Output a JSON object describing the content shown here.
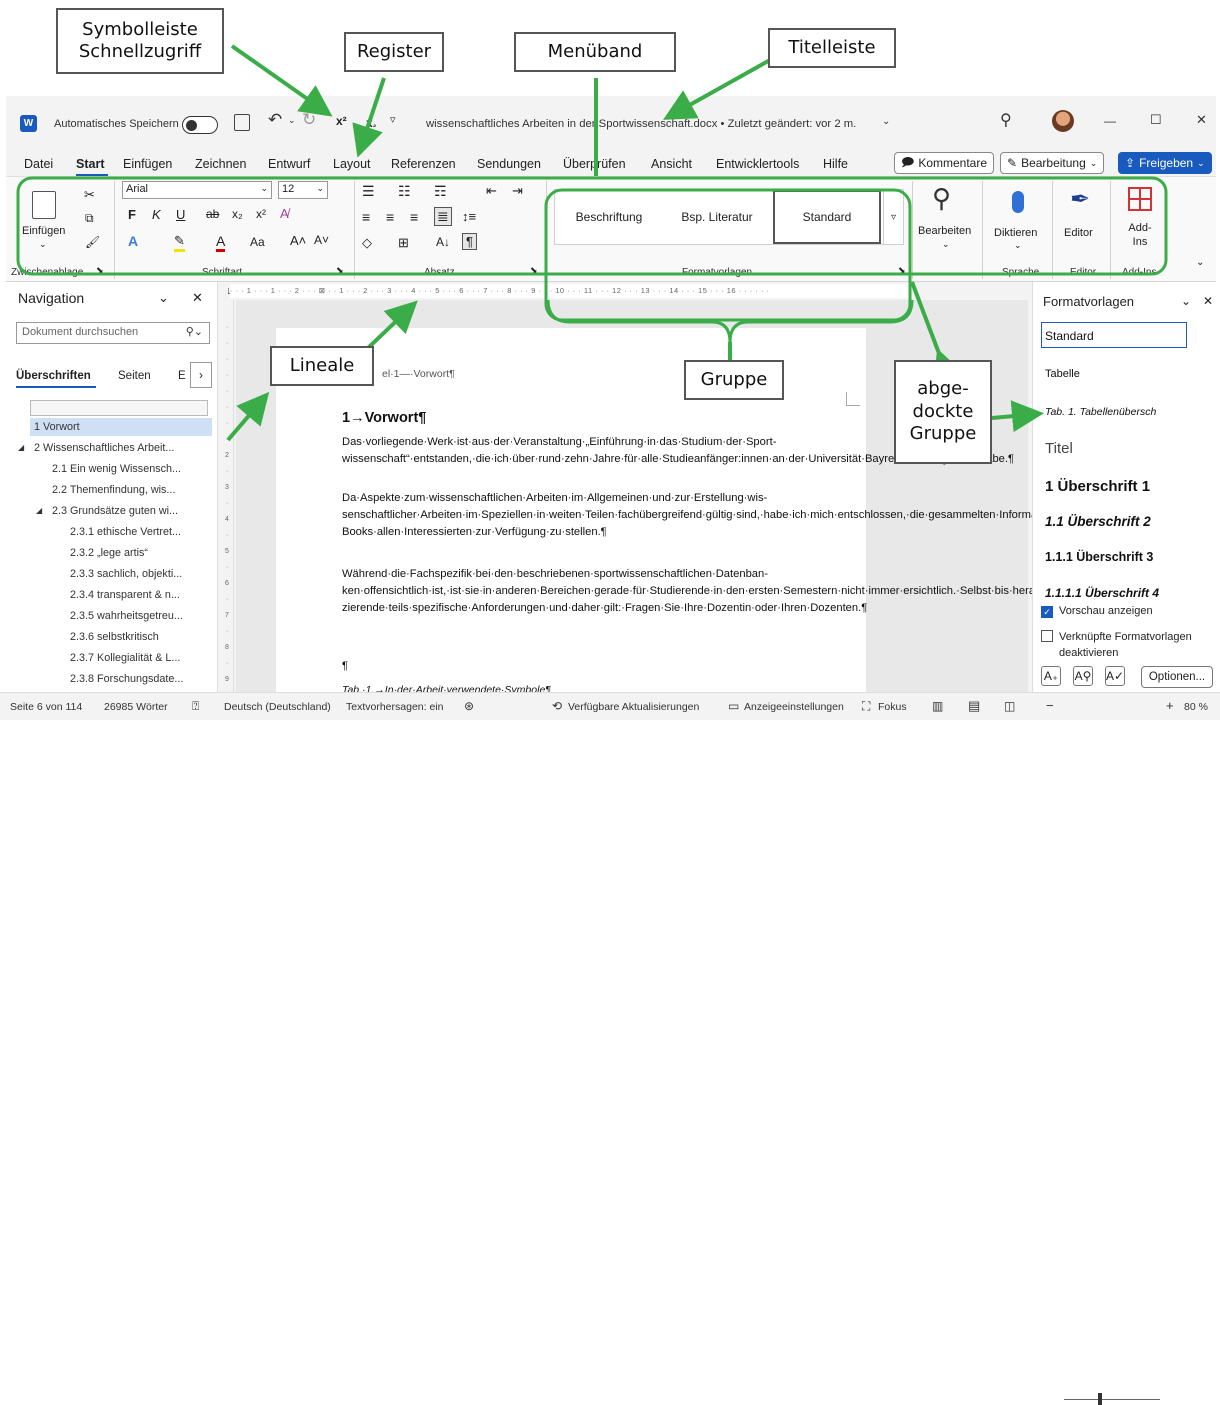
{
  "annotations": {
    "quick_access": "Symbolleiste\nSchnellzugriff",
    "register": "Register",
    "ribbon": "Menüband",
    "titlebar": "Titelleiste",
    "rulers": "Lineale",
    "group": "Gruppe",
    "docked_group": "abge-\ndockte\nGruppe"
  },
  "titlebar": {
    "autosave_label": "Automatisches Speichern",
    "doc_title": "wissenschaftliches Arbeiten in der Sportwissenschaft.docx • Zuletzt geändert: vor 2 m.",
    "minimize": "—",
    "maximize": "☐",
    "close": "✕"
  },
  "tabs": [
    "Datei",
    "Start",
    "Einfügen",
    "Zeichnen",
    "Entwurf",
    "Layout",
    "Referenzen",
    "Sendungen",
    "Überprüfen",
    "Ansicht",
    "Entwicklertools",
    "Hilfe"
  ],
  "tab_buttons": {
    "comments": "Kommentare",
    "editing": "Bearbeitung",
    "share": "Freigeben"
  },
  "ribbon": {
    "clipboard": {
      "paste": "Einfügen",
      "label": "Zwischenablage"
    },
    "font": {
      "name": "Arial",
      "size": "12",
      "label": "Schriftart",
      "bold": "F",
      "italic": "K",
      "underline": "U",
      "case": "Aa"
    },
    "paragraph": {
      "label": "Absatz"
    },
    "styles": {
      "items": [
        "Beschriftung",
        "Bsp. Literatur",
        "Standard"
      ],
      "label": "Formatvorlagen"
    },
    "editing": {
      "label": "Bearbeiten"
    },
    "voice": {
      "dictate": "Diktieren",
      "label": "Sprache"
    },
    "editor": {
      "button": "Editor",
      "label": "Editor"
    },
    "addins": {
      "button": "Add-Ins",
      "label": "Add-Ins"
    }
  },
  "navigation": {
    "title": "Navigation",
    "search_placeholder": "Dokument durchsuchen",
    "tabs": [
      "Überschriften",
      "Seiten",
      "E"
    ],
    "items": [
      "1 Vorwort",
      "2 Wissenschaftliches Arbeit...",
      "2.1 Ein wenig Wissensch...",
      "2.2 Themenfindung, wis...",
      "2.3 Grundsätze guten wi...",
      "2.3.1 ethische Vertret...",
      "2.3.2 „lege artis“",
      "2.3.3 sachlich, objekti...",
      "2.3.4 transparent & n...",
      "2.3.5 wahrheitsgetreu...",
      "2.3.6 selbstkritisch",
      "2.3.7 Kollegialität & L...",
      "2.3.8 Forschungsdate..."
    ]
  },
  "document": {
    "header_text": "el·1—·Vorwort¶",
    "heading": "1→Vorwort¶",
    "p1": "Das·vorliegende·Werk·ist·aus·der·Veranstaltung·„Einführung·in·das·Studium·der·Sport-wissenschaft“·entstanden,·die·ich·über·rund·zehn·Jahre·für·alle·Studieanfänger:innen·an·der·Universität·Bayreuth·durchgeführt·habe.¶",
    "p2": "Da·Aspekte·zum·wissenschaftlichen·Arbeiten·im·Allgemeinen·und·zur·Erstellung·wis-senschaftlicher·Arbeiten·im·Speziellen·in·weiten·Teilen·fachübergreifend·gültig·sind,·habe·ich·mich·entschlossen,·die·gesammelten·Informationen·in·Form·dieses·E-Books·allen·Interessierten·zur·Verfügung·zu·stellen.¶",
    "p3": "Während·die·Fachspezifik·bei·den·beschriebenen·sportwissenschaftlichen·Datenban-ken·offensichtlich·ist,·ist·sie·in·anderen·Bereichen·gerade·für·Studierende·in·den·ersten·Semestern·nicht·immer·ersichtlich.·Selbst·bis·herab·auf·die·Lehrstuhlebene·stellen·Do-zierende·teils·spezifische·Anforderungen·und·daher·gilt:·Fragen·Sie·Ihre·Dozentin·oder·Ihren·Dozenten.¶",
    "p4": "¶",
    "caption": "Tab.·1.→In·der·Arbeit·verwendete·Symbole¶"
  },
  "styles_pane": {
    "title": "Formatvorlagen",
    "items": [
      "Standard",
      "Tabelle",
      "Tab. 1.  Tabellenübersch",
      "Titel",
      "1  Überschrift 1",
      "1.1  Überschrift 2",
      "1.1.1  Überschrift 3",
      "1.1.1.1  Überschrift 4"
    ],
    "preview_label": "Vorschau anzeigen",
    "linked_label": "Verknüpfte Formatvorlagen deaktivieren",
    "options": "Optionen..."
  },
  "status": {
    "page": "Seite 6 von 114",
    "words": "26985 Wörter",
    "language": "Deutsch (Deutschland)",
    "predictions": "Textvorhersagen: ein",
    "updates": "Verfügbare Aktualisierungen",
    "display": "Anzeigeeinstellungen",
    "focus": "Fokus",
    "zoom": "80 %"
  },
  "colors": {
    "accent": "#185abd",
    "arrow": "#3aad48",
    "ribbon_outline": "#3aad48"
  }
}
